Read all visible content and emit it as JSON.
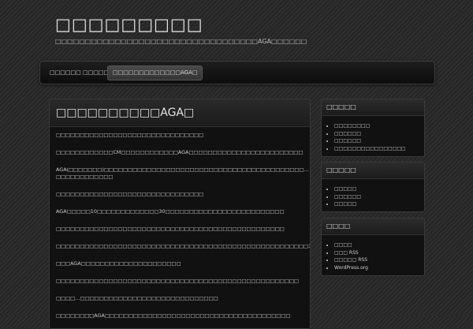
{
  "site": {
    "title": "□□□□□□□□□",
    "tagline": "□□□□□□□□□□□□□□□□□□□□□□□□□□□□□□□□□□AGA□□□□□□"
  },
  "nav": {
    "items": [
      {
        "label": "□□□□□□"
      },
      {
        "label": "□□□□□"
      },
      {
        "label": "□□□□□□□□□□□□□AGA□"
      }
    ]
  },
  "post": {
    "title": "□□□□□□□□□□AGA□",
    "paragraphs": [
      "□□□□□□□□□□□□□□□□□□□□□□□□□□□□□□□",
      "□□□□□□□□□□□□CM□□□□□□□□□□□□AGA□□□□□□□□□□□□□□□□□□□□□□□□",
      "AGA(□□□□□□□)□□□□□□□□□□□□□□□□□□□□□□□□□□□□□□□□□□□□□□□□□□…□□□□□□□□□□□□",
      "□□□□□□□□□□□□□□□□□□□□□□□□□□□□□□□",
      "AGA□□□□□10□□□□□□□□□□□□□30□□□□□□□□□□□□□□□□□□□□□□□□□",
      "□□□□□□□□□□□□□□□□□□□□□□□□□□□□□□□□□□□□□□□□□□□□□□□□",
      "□□□□□□□□□□□□□□□□□□□□□□□□□□□□□□□□□□□□□□□□□□□□□□□□□□□□□3□6□□□□□□□□□□□□□□□□□□□□□□□□□□□□□□□□□□□□□□□□□□□□□□□□□□",
      "□□□AGA□□□□□□□□□□□□□□□□□□□□□",
      "□□□□□□□□□□□□□□□□□□□□□□□□□□□□□□□□□□□□□□□□□□□□□□□□□□□",
      "□□□□…□□□□□□□□□□□□□□□□□□□□□□□□□□□□□",
      "□□□□□□□□AGA□□□□□□□□□□□□□□□□□□□□□□□□□□□□□□□□□□□□□□□"
    ]
  },
  "sidebar": {
    "widgets": [
      {
        "title": "□□□□□",
        "items": [
          "□□□□□□□□",
          "□□□□□□",
          "□□□□□□",
          "□□□□□□□□□□□□□□□□"
        ]
      },
      {
        "title": "□□□□□",
        "items": [
          "□□□□□",
          "□□□□□□",
          "□□□□□"
        ]
      },
      {
        "title": "□□□□",
        "items": [
          "□□□□",
          "□□□ RSS",
          "□□□□□ RSS",
          "WordPress.org"
        ]
      }
    ]
  }
}
